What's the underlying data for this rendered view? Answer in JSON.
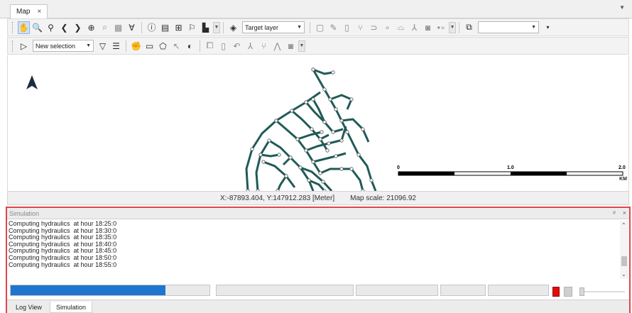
{
  "document_tab": {
    "label": "Map",
    "close": "×"
  },
  "toolbar1": {
    "icons": [
      "pan-hand",
      "zoom-in",
      "zoom-out",
      "back",
      "forward",
      "full-extent",
      "zoom-selection",
      "zoom-layer",
      "zoom-features",
      "info",
      "table",
      "identify",
      "flag",
      "chart"
    ],
    "target_layer_label": "Target layer",
    "edit_icons": [
      "new",
      "edit",
      "delete",
      "split",
      "merge",
      "node",
      "node-edit",
      "vertex",
      "snap",
      "move"
    ]
  },
  "toolbar2": {
    "selection_mode": "New selection",
    "icons": [
      "select-pointer",
      "filter",
      "list",
      "hand-select",
      "rect",
      "polygon",
      "lasso",
      "circle",
      "copy",
      "paste",
      "undo",
      "tools",
      "branch",
      "connect",
      "camera"
    ]
  },
  "map": {
    "network_color": "#1f5b56",
    "scale_labels": [
      "0",
      "1.0",
      "2.0"
    ],
    "scale_unit": "KM"
  },
  "status": {
    "coords": "X:-87893.404, Y:147912.283 [Meter]",
    "scale": "Map scale: 21096.92"
  },
  "simulation": {
    "title": "Simulation",
    "pin": "ᵖ",
    "close": "×",
    "log": [
      "Computing hydraulics  at hour 18:25:0",
      "Computing hydraulics  at hour 18:30:0",
      "Computing hydraulics  at hour 18:35:0",
      "Computing hydraulics  at hour 18:40:0",
      "Computing hydraulics  at hour 18:45:0",
      "Computing hydraulics  at hour 18:50:0",
      "Computing hydraulics  at hour 18:55:0"
    ],
    "progress_fraction": 0.78,
    "accent": "#1f75d0",
    "stop_color": "#e10b0b"
  },
  "bottom_tabs": {
    "log": "Log View",
    "simulation": "Simulation"
  }
}
